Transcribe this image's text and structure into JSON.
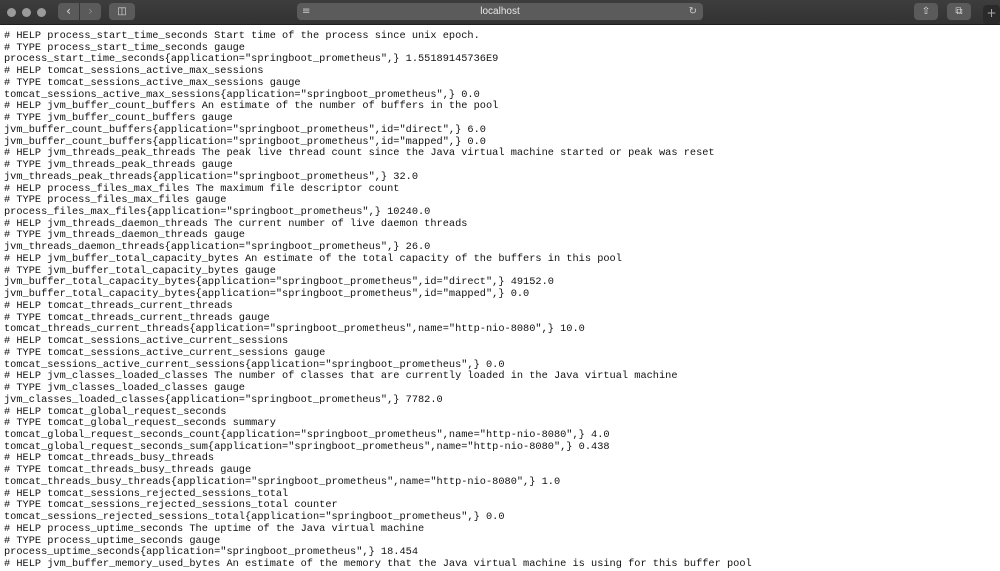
{
  "browser": {
    "url": "localhost",
    "icons": [
      "close-dot",
      "minimize-dot",
      "zoom-dot",
      "back-icon",
      "forward-icon",
      "sidebar-icon",
      "reader-icon",
      "reload-icon",
      "share-icon",
      "tabs-icon",
      "new-tab-icon"
    ]
  },
  "lines": [
    "# HELP process_start_time_seconds Start time of the process since unix epoch.",
    "# TYPE process_start_time_seconds gauge",
    "process_start_time_seconds{application=\"springboot_prometheus\",} 1.55189145736E9",
    "# HELP tomcat_sessions_active_max_sessions",
    "# TYPE tomcat_sessions_active_max_sessions gauge",
    "tomcat_sessions_active_max_sessions{application=\"springboot_prometheus\",} 0.0",
    "# HELP jvm_buffer_count_buffers An estimate of the number of buffers in the pool",
    "# TYPE jvm_buffer_count_buffers gauge",
    "jvm_buffer_count_buffers{application=\"springboot_prometheus\",id=\"direct\",} 6.0",
    "jvm_buffer_count_buffers{application=\"springboot_prometheus\",id=\"mapped\",} 0.0",
    "# HELP jvm_threads_peak_threads The peak live thread count since the Java virtual machine started or peak was reset",
    "# TYPE jvm_threads_peak_threads gauge",
    "jvm_threads_peak_threads{application=\"springboot_prometheus\",} 32.0",
    "# HELP process_files_max_files The maximum file descriptor count",
    "# TYPE process_files_max_files gauge",
    "process_files_max_files{application=\"springboot_prometheus\",} 10240.0",
    "# HELP jvm_threads_daemon_threads The current number of live daemon threads",
    "# TYPE jvm_threads_daemon_threads gauge",
    "jvm_threads_daemon_threads{application=\"springboot_prometheus\",} 26.0",
    "# HELP jvm_buffer_total_capacity_bytes An estimate of the total capacity of the buffers in this pool",
    "# TYPE jvm_buffer_total_capacity_bytes gauge",
    "jvm_buffer_total_capacity_bytes{application=\"springboot_prometheus\",id=\"direct\",} 49152.0",
    "jvm_buffer_total_capacity_bytes{application=\"springboot_prometheus\",id=\"mapped\",} 0.0",
    "# HELP tomcat_threads_current_threads",
    "# TYPE tomcat_threads_current_threads gauge",
    "tomcat_threads_current_threads{application=\"springboot_prometheus\",name=\"http-nio-8080\",} 10.0",
    "# HELP tomcat_sessions_active_current_sessions",
    "# TYPE tomcat_sessions_active_current_sessions gauge",
    "tomcat_sessions_active_current_sessions{application=\"springboot_prometheus\",} 0.0",
    "# HELP jvm_classes_loaded_classes The number of classes that are currently loaded in the Java virtual machine",
    "# TYPE jvm_classes_loaded_classes gauge",
    "jvm_classes_loaded_classes{application=\"springboot_prometheus\",} 7782.0",
    "# HELP tomcat_global_request_seconds",
    "# TYPE tomcat_global_request_seconds summary",
    "tomcat_global_request_seconds_count{application=\"springboot_prometheus\",name=\"http-nio-8080\",} 4.0",
    "tomcat_global_request_seconds_sum{application=\"springboot_prometheus\",name=\"http-nio-8080\",} 0.438",
    "# HELP tomcat_threads_busy_threads",
    "# TYPE tomcat_threads_busy_threads gauge",
    "tomcat_threads_busy_threads{application=\"springboot_prometheus\",name=\"http-nio-8080\",} 1.0",
    "# HELP tomcat_sessions_rejected_sessions_total",
    "# TYPE tomcat_sessions_rejected_sessions_total counter",
    "tomcat_sessions_rejected_sessions_total{application=\"springboot_prometheus\",} 0.0",
    "# HELP process_uptime_seconds The uptime of the Java virtual machine",
    "# TYPE process_uptime_seconds gauge",
    "process_uptime_seconds{application=\"springboot_prometheus\",} 18.454",
    "# HELP jvm_buffer_memory_used_bytes An estimate of the memory that the Java virtual machine is using for this buffer pool"
  ]
}
